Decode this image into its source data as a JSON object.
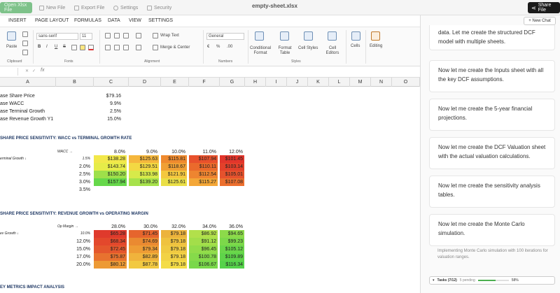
{
  "topbar": {
    "open_label": "Open Xlsx File",
    "new_file": "New File",
    "export_file": "Export File",
    "settings": "Settings",
    "security": "Security",
    "title": "empty-sheet.xlsx",
    "share_label": "Share File"
  },
  "tabs": [
    "INSERT",
    "PAGE LAYOUT",
    "FORMULAS",
    "DATA",
    "VIEW",
    "SETTINGS"
  ],
  "ribbon": {
    "paste": "Paste",
    "clipboard": "Clipboard",
    "font_name": "sans-serif",
    "font_size": "11",
    "fonts": "Fonts",
    "wrap_text": "Wrap Text",
    "merge_center": "Merge & Center",
    "alignment": "Alignment",
    "number_format": "General",
    "numbers": "Numbers",
    "conditional_format": "Conditional Format",
    "format_table": "Format Table",
    "cell_styles": "Cell Styles",
    "cell_editors": "Cell Editors",
    "styles": "Styles",
    "cells": "Cells",
    "editing": "Editing",
    "bold": "B",
    "italic": "I",
    "underline": "U",
    "strike": "S",
    "percent": "%",
    "decimals": ".00",
    "currency": "€"
  },
  "formula": {
    "fx": "fx"
  },
  "columns": [
    "A",
    "B",
    "C",
    "D",
    "E",
    "F",
    "G",
    "H",
    "I",
    "J",
    "K",
    "L",
    "M",
    "N",
    "O"
  ],
  "assumptions": [
    {
      "label": "ase Share Price",
      "value": "$79.16"
    },
    {
      "label": "ase WACC",
      "value": "9.9%"
    },
    {
      "label": "ase Terminal Growth",
      "value": "2.5%"
    },
    {
      "label": "ase Revenue Growth Y1",
      "value": "15.0%"
    }
  ],
  "table1": {
    "title": "SHARE PRICE SENSITIVITY: WACC vs TERMINAL GROWTH RATE",
    "corner": "WACC →",
    "row_axis": "erminal Growth ↓",
    "cols": [
      "8.0%",
      "9.0%",
      "10.0%",
      "11.0%",
      "12.0%"
    ],
    "rows": [
      {
        "label": "1.5%",
        "values": [
          "$138.28",
          "$125.63",
          "$115.81",
          "$107.94",
          "$101.45"
        ]
      },
      {
        "label": "2.0%",
        "values": [
          "$143.74",
          "$129.51",
          "$118.67",
          "$110.11",
          "$103.14"
        ]
      },
      {
        "label": "2.5%",
        "values": [
          "$150.20",
          "$133.98",
          "$121.91",
          "$112.54",
          "$105.01"
        ]
      },
      {
        "label": "3.0%",
        "values": [
          "$157.94",
          "$139.20",
          "$125.61",
          "$115.27",
          "$107.08"
        ]
      },
      {
        "label": "3.5%",
        "values": []
      }
    ],
    "colors": [
      [
        "#f2e84a",
        "#f5b73d",
        "#ef8a2e",
        "#e8512c",
        "#e2352b"
      ],
      [
        "#e6ec49",
        "#f3d843",
        "#f0a035",
        "#ea6a2c",
        "#e3412b"
      ],
      [
        "#9ee04a",
        "#d7ea4a",
        "#f4c83f",
        "#ee8530",
        "#e5522d"
      ],
      [
        "#66d84a",
        "#a7e24b",
        "#eadf46",
        "#f4a737",
        "#ec6f2e"
      ]
    ]
  },
  "table2": {
    "title": "SHARE PRICE SENSITIVITY: REVENUE GROWTH vs OPERATING MARGIN",
    "corner": "Op Margin →",
    "row_axis": "ev Growth ↓",
    "cols": [
      "28.0%",
      "30.0%",
      "32.0%",
      "34.0%",
      "36.0%"
    ],
    "rows": [
      {
        "label": "10.0%",
        "values": [
          "$65.28",
          "$71.45",
          "$79.18",
          "$86.92",
          "$94.65"
        ]
      },
      {
        "label": "12.0%",
        "values": [
          "$68.34",
          "$74.69",
          "$79.18",
          "$91.12",
          "$99.23"
        ]
      },
      {
        "label": "15.0%",
        "values": [
          "$72.45",
          "$79.34",
          "$79.18",
          "$96.45",
          "$105.12"
        ]
      },
      {
        "label": "17.0%",
        "values": [
          "$75.87",
          "$82.89",
          "$79.18",
          "$100.78",
          "$109.89"
        ]
      },
      {
        "label": "20.0%",
        "values": [
          "$80.12",
          "$87.78",
          "$79.18",
          "$106.67",
          "$116.34"
        ]
      }
    ],
    "colors": [
      [
        "#df3a2c",
        "#e6652d",
        "#ecb33c",
        "#b2e04b",
        "#8cda4a"
      ],
      [
        "#e3482c",
        "#ea8a31",
        "#efc23f",
        "#a3de4a",
        "#7cd84a"
      ],
      [
        "#e4572d",
        "#ee9c35",
        "#f0ca42",
        "#93dc4a",
        "#6ad64a"
      ],
      [
        "#e8722f",
        "#f0b33c",
        "#f2d245",
        "#86da4a",
        "#5fd44a"
      ],
      [
        "#ed9a35",
        "#f2c941",
        "#f4dc47",
        "#7ad84a",
        "#55d24a"
      ]
    ]
  },
  "table3_title": "EY METRICS IMPACT ANALYSIS",
  "panel": {
    "new_chat": "+ New Chat",
    "top_message": "data. Let me create the structured DCF model with multiple sheets.",
    "messages": [
      "Now let me create the Inputs sheet with all the key DCF assumptions.",
      "Now let me create the 5-year financial projections.",
      "Now let me create the DCF Valuation sheet with the actual valuation calculations.",
      "Now let me create the sensitivity analysis tables.",
      "Now let me create the Monte Carlo simulation."
    ],
    "status": "Implementing Monte Carlo simulation with 100 iterations for valuation ranges.",
    "tasks_label": "Tasks (7/12)",
    "tasks_pending": "5 pending",
    "tasks_percent": "58%",
    "tasks_progress": 0.58
  }
}
